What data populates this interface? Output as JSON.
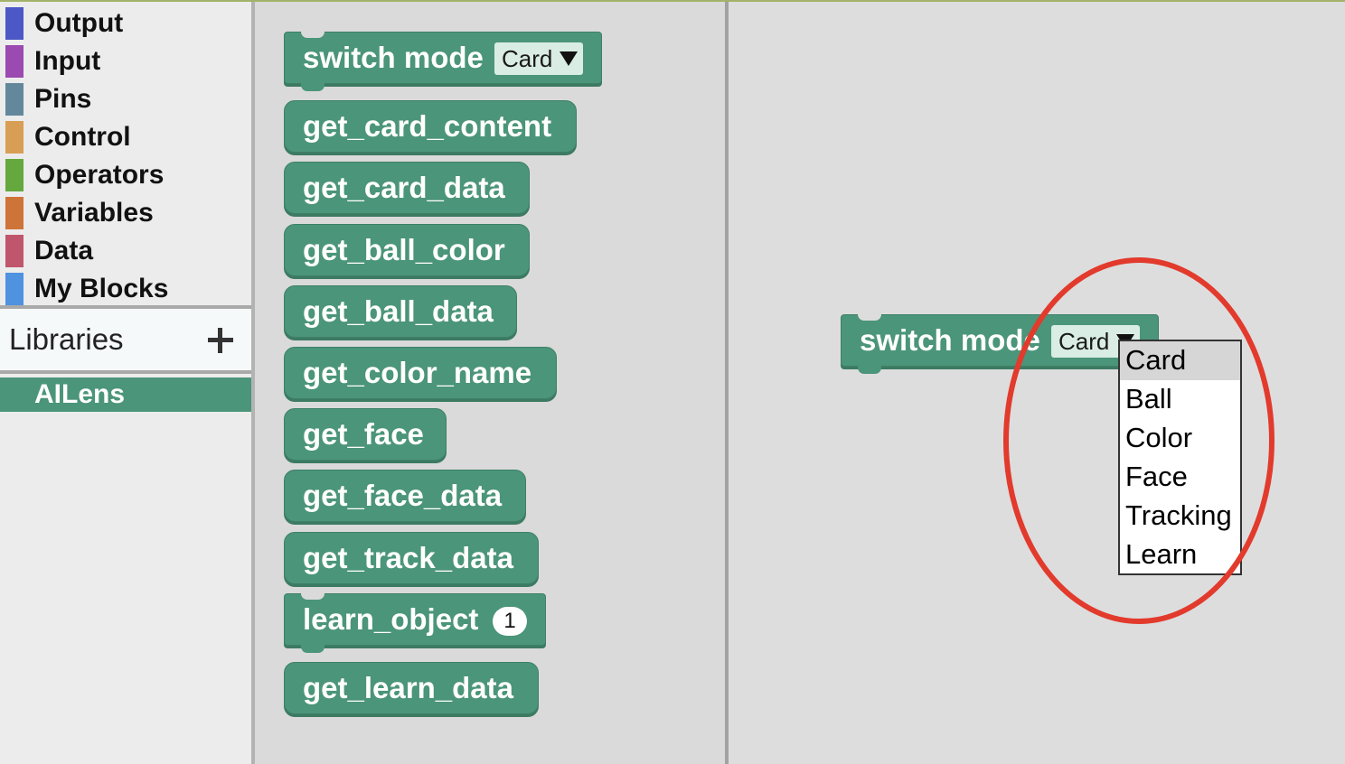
{
  "sidebar": {
    "categories": [
      {
        "label": "Output",
        "color": "#4c58c6"
      },
      {
        "label": "Input",
        "color": "#9a4ab1"
      },
      {
        "label": "Pins",
        "color": "#63889c"
      },
      {
        "label": "Control",
        "color": "#d99e55"
      },
      {
        "label": "Operators",
        "color": "#64a83e"
      },
      {
        "label": "Variables",
        "color": "#cf7439"
      },
      {
        "label": "Data",
        "color": "#c0566b"
      },
      {
        "label": "My Blocks",
        "color": "#4f92df"
      }
    ],
    "libraries_label": "Libraries",
    "libraries": [
      {
        "label": "AILens"
      }
    ]
  },
  "flyout": {
    "blocks": [
      {
        "label": "switch mode",
        "dropdown_value": "Card"
      },
      {
        "label": "get_card_content"
      },
      {
        "label": "get_card_data"
      },
      {
        "label": "get_ball_color"
      },
      {
        "label": "get_ball_data"
      },
      {
        "label": "get_color_name"
      },
      {
        "label": "get_face"
      },
      {
        "label": "get_face_data"
      },
      {
        "label": "get_track_data"
      },
      {
        "label": "learn_object",
        "number_value": "1"
      },
      {
        "label": "get_learn_data"
      }
    ]
  },
  "workspace": {
    "block": {
      "label": "switch mode",
      "dropdown_value": "Card"
    },
    "menu": {
      "options": [
        "Card",
        "Ball",
        "Color",
        "Face",
        "Tracking",
        "Learn"
      ],
      "selected": "Card"
    }
  },
  "colors": {
    "block_fill": "#4b957a",
    "annotation": "#e23a2c"
  }
}
